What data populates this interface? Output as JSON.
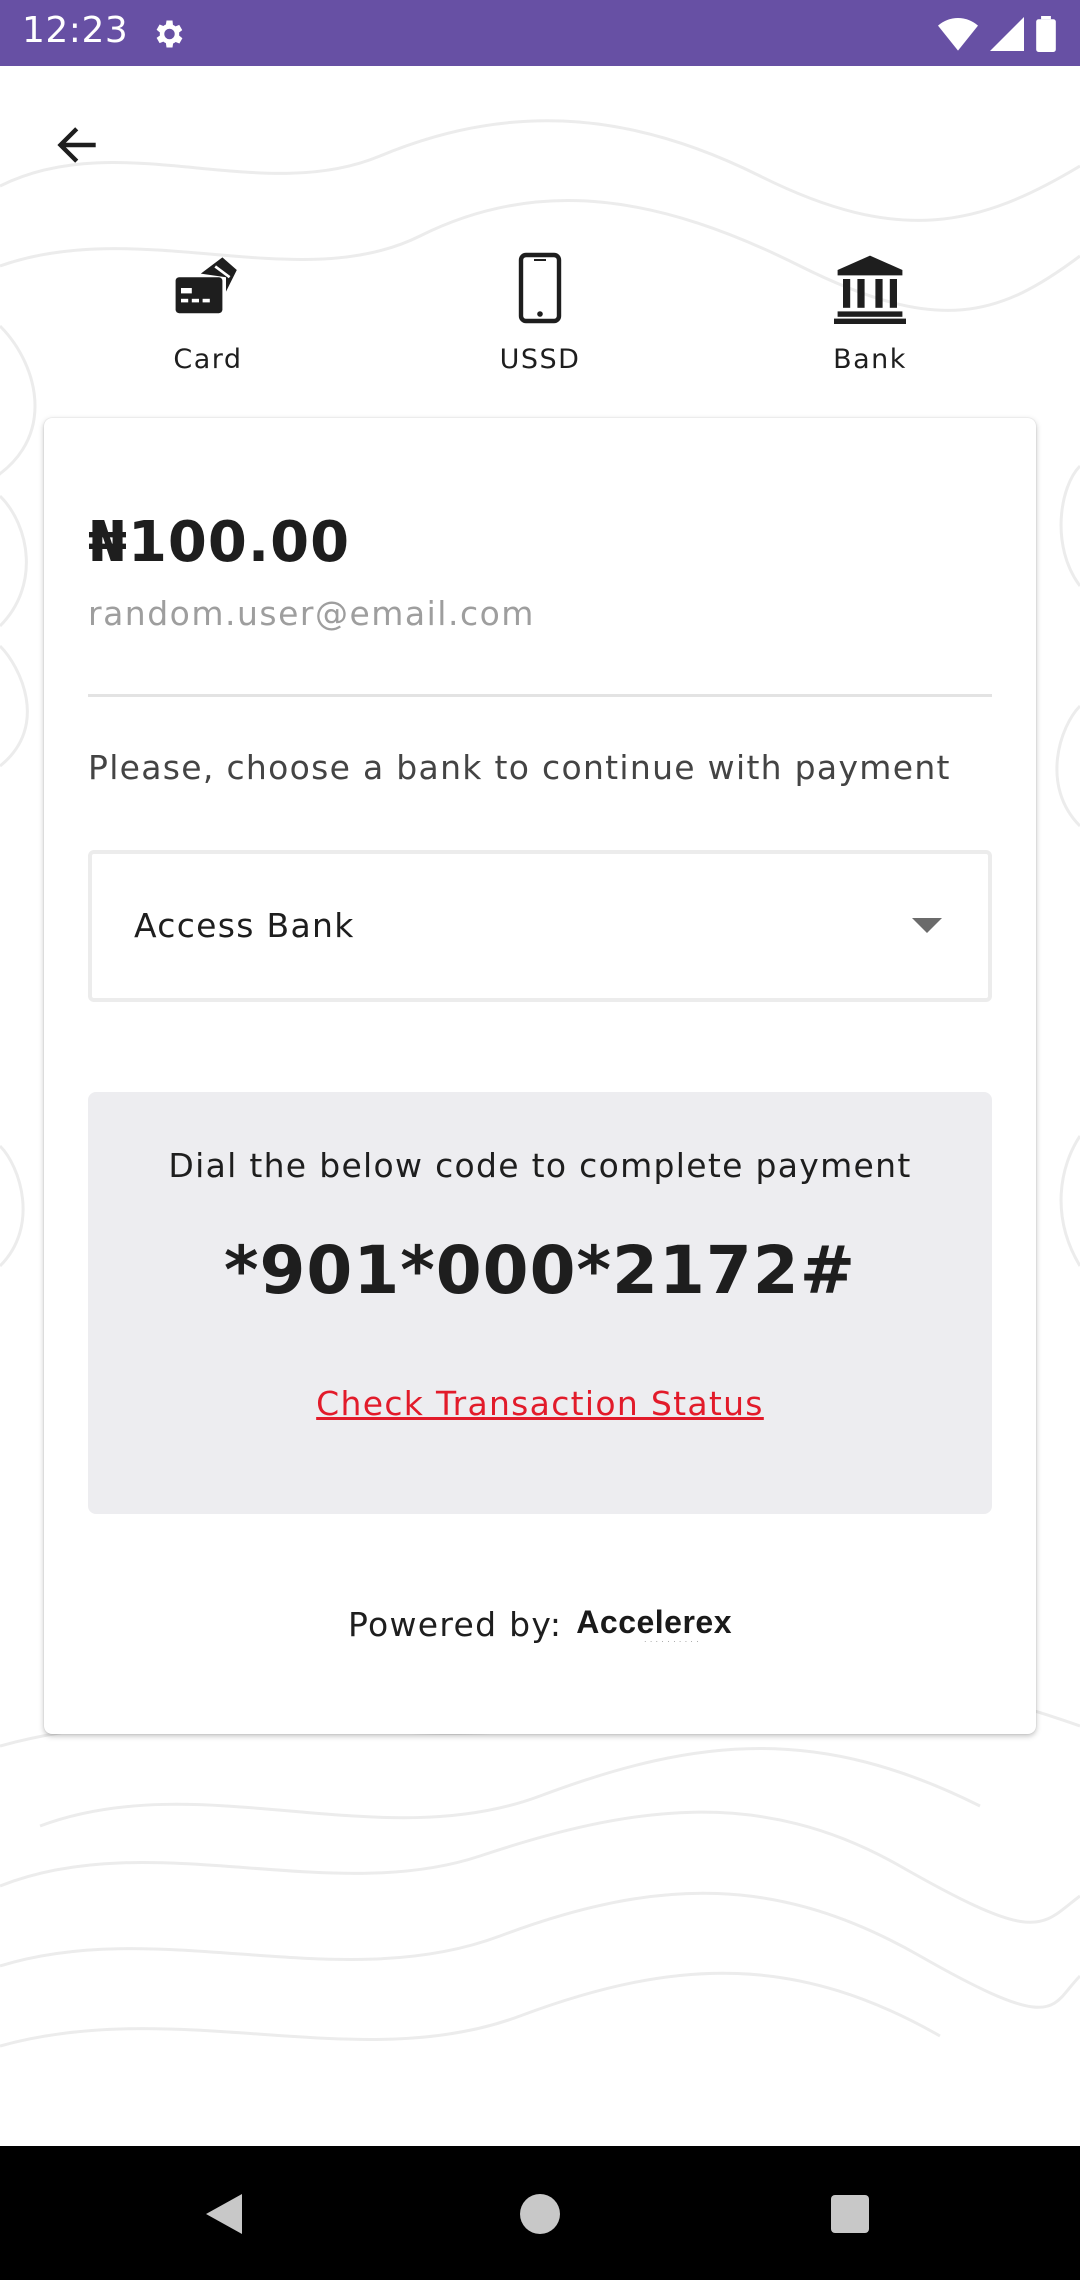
{
  "status_bar": {
    "time": "12:23",
    "icons": [
      "gear-icon",
      "wifi-icon",
      "signal-icon",
      "battery-icon"
    ],
    "background": "#6750a4"
  },
  "navigation": {
    "back_icon": "arrow-left-icon"
  },
  "tabs": [
    {
      "label": "Card",
      "icon": "credit-card-icon"
    },
    {
      "label": "USSD",
      "icon": "smartphone-icon"
    },
    {
      "label": "Bank",
      "icon": "bank-icon"
    }
  ],
  "payment": {
    "amount": "₦100.00",
    "email": "random.user@email.com",
    "instruction": "Please, choose a bank to continue with payment",
    "selected_bank": "Access Bank",
    "dial_instruction": "Dial the below code to complete payment",
    "ussd_code": "*901*000*2172#",
    "check_status_link": "Check Transaction Status",
    "link_color": "#e21b2a"
  },
  "footer": {
    "powered_by_label": "Powered by:",
    "brand_logo_text": "Accelerex"
  },
  "system_nav": [
    "back-triangle-icon",
    "home-circle-icon",
    "recents-square-icon"
  ]
}
